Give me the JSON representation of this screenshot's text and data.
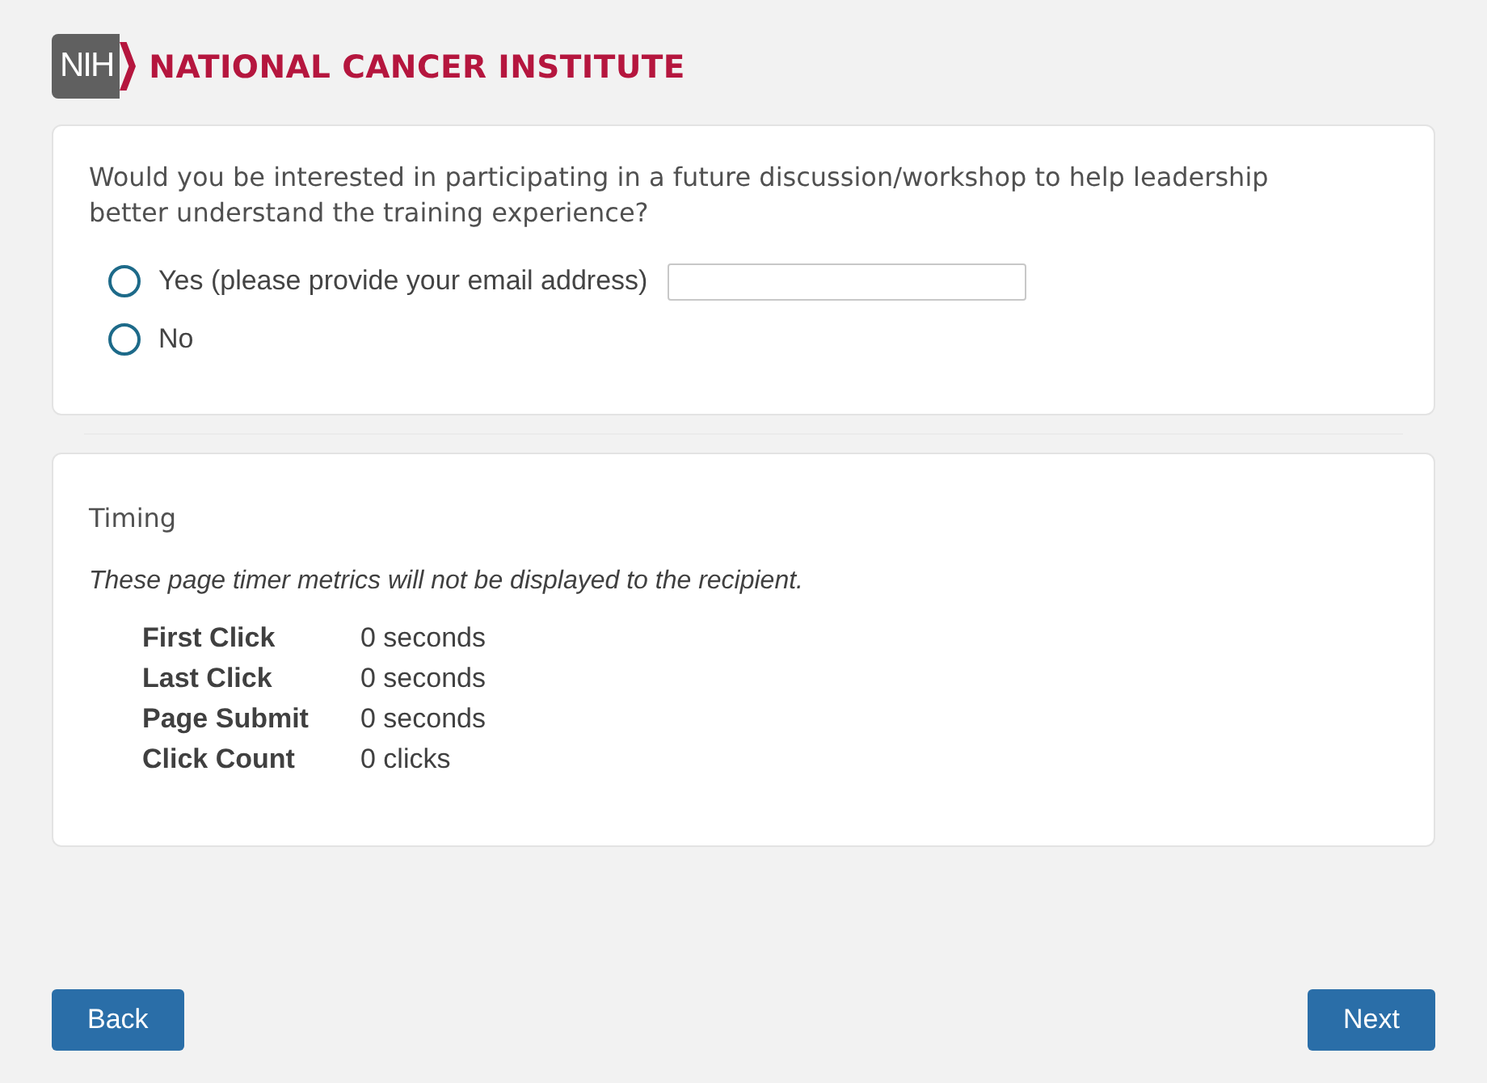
{
  "header": {
    "logo_mark": "NIH",
    "org_name": "NATIONAL CANCER INSTITUTE"
  },
  "question": {
    "text": "Would you be interested in participating in a future discussion/workshop to help leadership better understand the training experience?",
    "options": [
      {
        "label": "Yes (please provide your email address)",
        "selected": false,
        "has_field": true
      },
      {
        "label": "No",
        "selected": false,
        "has_field": false
      }
    ]
  },
  "timing": {
    "title": "Timing",
    "note": "These page timer metrics will not be displayed to the recipient.",
    "metrics": [
      {
        "label": "First Click",
        "value": "0 seconds"
      },
      {
        "label": "Last Click",
        "value": "0 seconds"
      },
      {
        "label": "Page Submit",
        "value": "0 seconds"
      },
      {
        "label": "Click Count",
        "value": "0 clicks"
      }
    ]
  },
  "buttons": {
    "back": "Back",
    "next": "Next"
  }
}
